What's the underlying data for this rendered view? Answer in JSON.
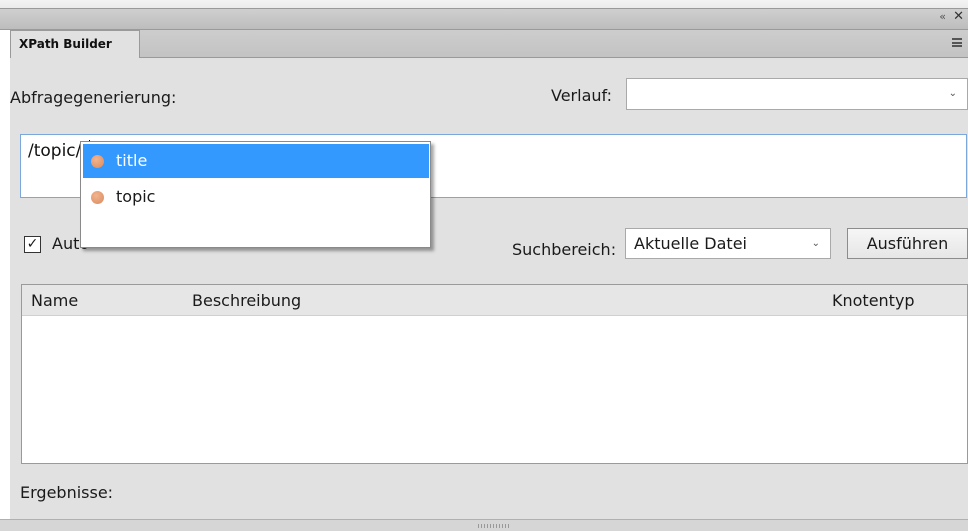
{
  "panel": {
    "collapse_glyph": "‹‹",
    "close_glyph": "✕",
    "tab_title": "XPath Builder"
  },
  "query": {
    "label": "Abfragegenerierung:",
    "value": "/topic/t",
    "history_label": "Verlauf:",
    "history_value": ""
  },
  "autocomplete": {
    "items": [
      {
        "label": "title",
        "selected": true
      },
      {
        "label": "topic",
        "selected": false
      }
    ]
  },
  "options": {
    "auto_checkbox_label": "Auto",
    "auto_checked": true,
    "scope_label": "Suchbereich:",
    "scope_value": "Aktuelle Datei",
    "run_button": "Ausführen"
  },
  "table": {
    "columns": [
      "Name",
      "Beschreibung",
      "Knotentyp"
    ],
    "rows": []
  },
  "footer": {
    "results_label": "Ergebnisse:"
  },
  "colors": {
    "selection": "#3399ff",
    "panel_bg": "#e1e1e1",
    "focus_border": "#7aa7dc",
    "node_dot": "#e09a70"
  }
}
